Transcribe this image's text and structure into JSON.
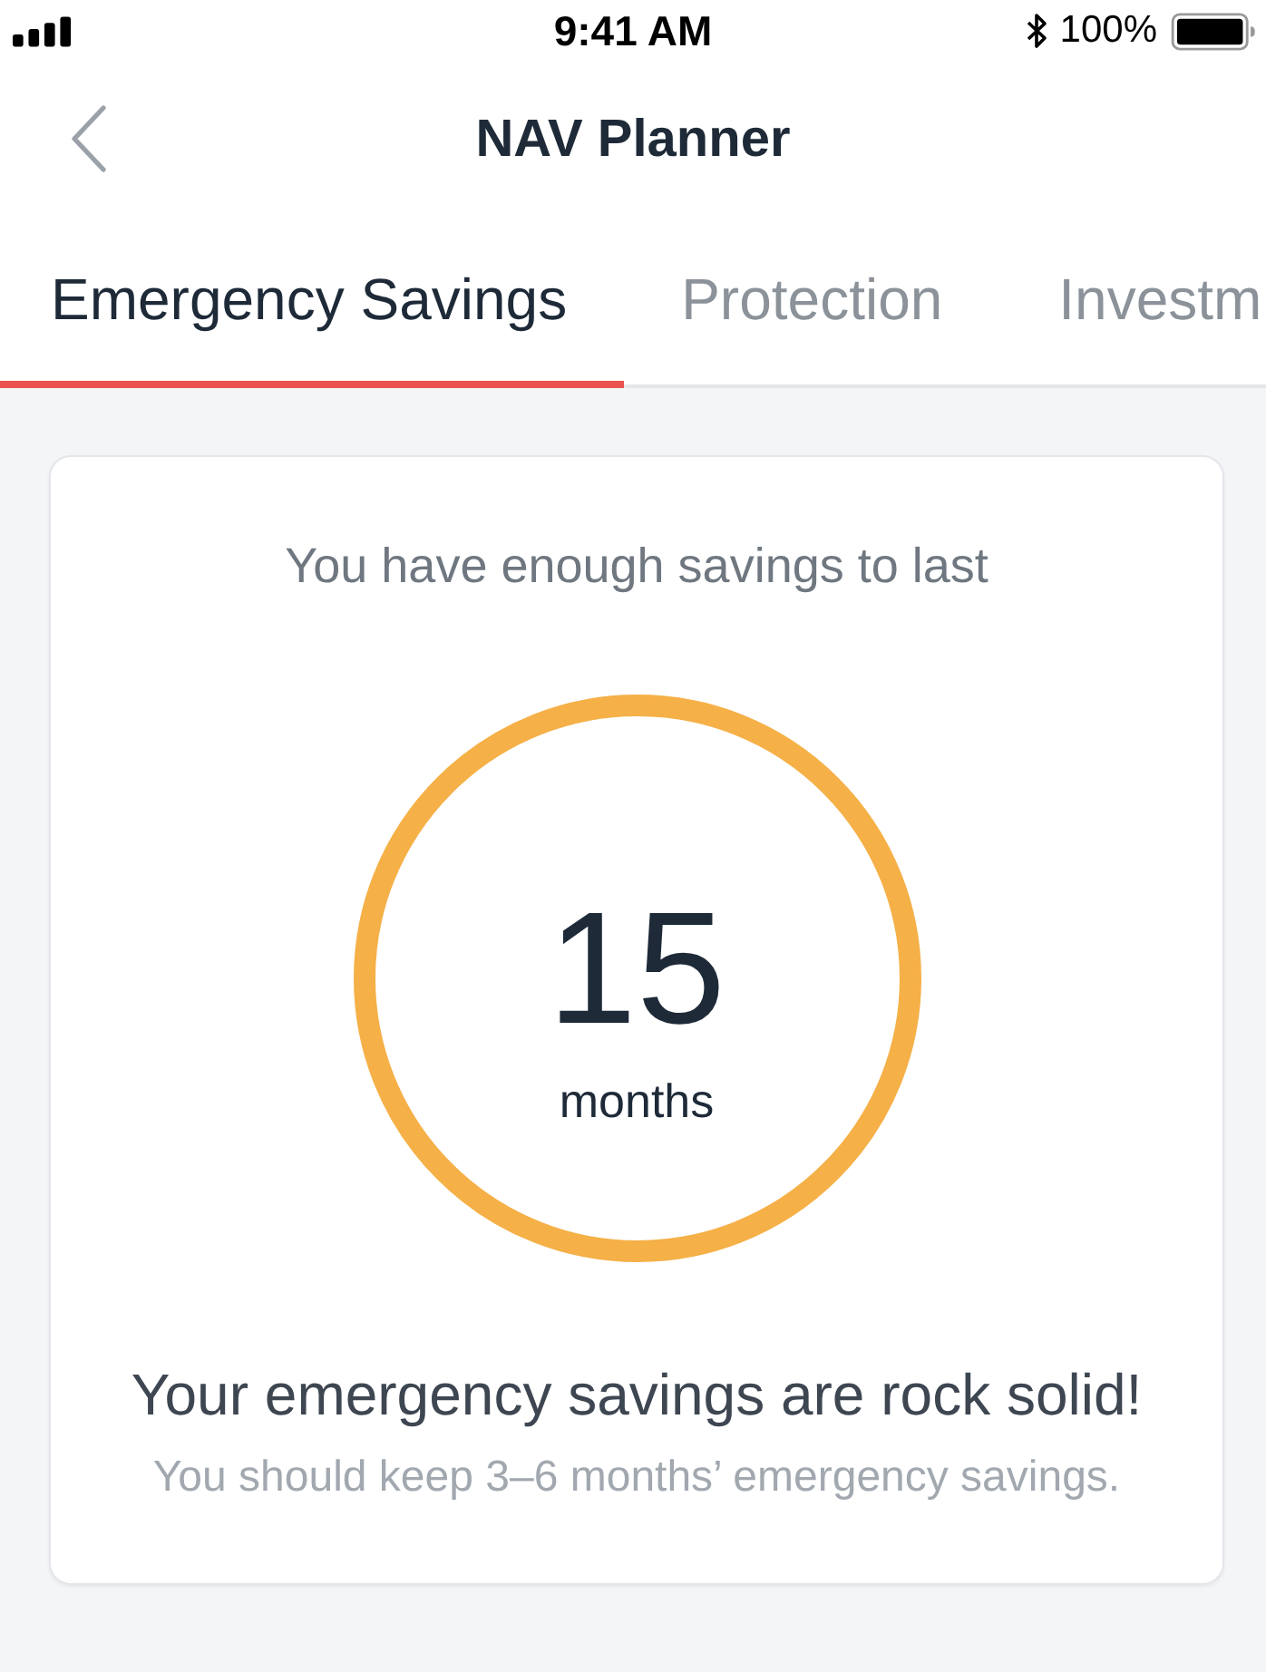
{
  "status_bar": {
    "time": "9:41 AM",
    "battery": "100%"
  },
  "nav_bar": {
    "title": "NAV Planner"
  },
  "tabs": [
    {
      "label": "Emergency Savings",
      "selected": true
    },
    {
      "label": "Protection",
      "selected": false
    },
    {
      "label": "Investm",
      "selected": false
    }
  ],
  "summary_card": {
    "intro": "You have enough savings to last",
    "value": "15",
    "unit": "months",
    "headline": "Your emergency savings are rock solid!",
    "note": "You should keep 3–6 months’ emergency savings."
  }
}
